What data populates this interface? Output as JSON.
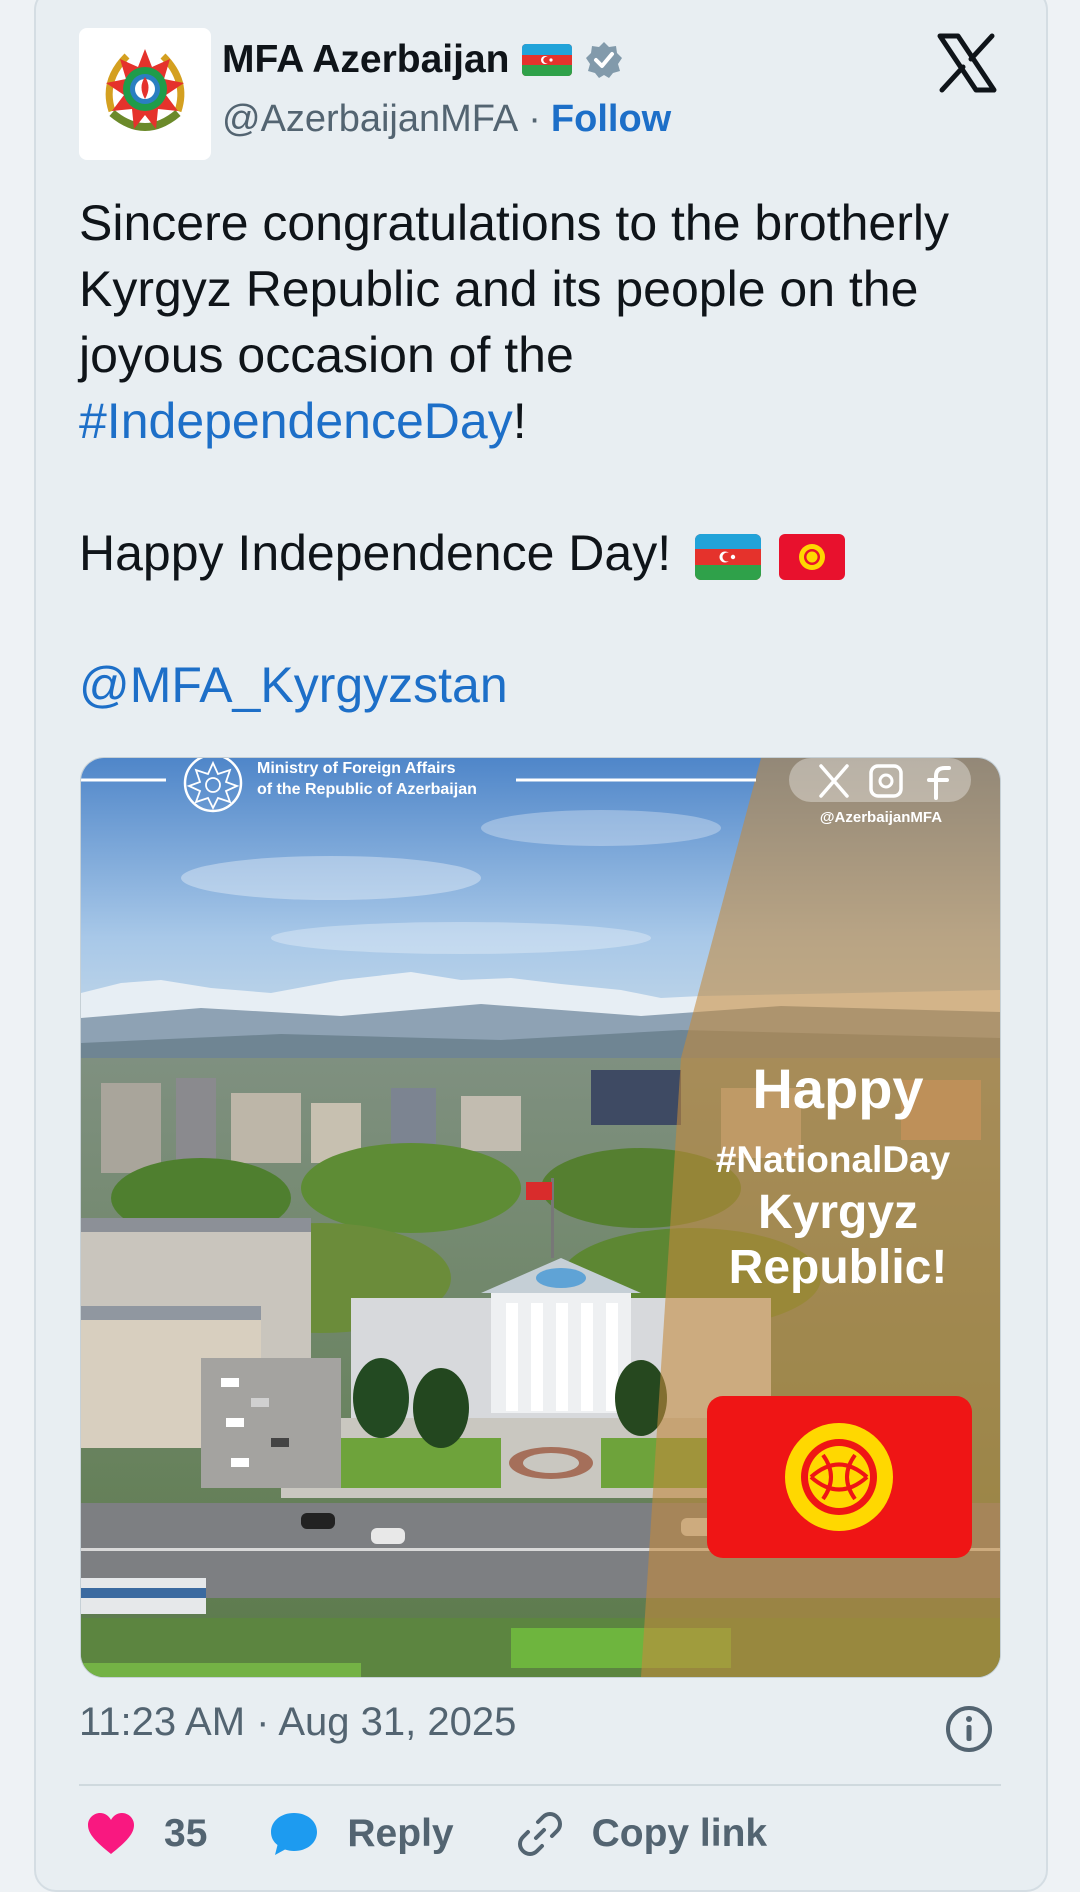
{
  "account": {
    "name": "MFA Azerbaijan",
    "handle": "@AzerbaijanMFA",
    "separator": "·",
    "follow_label": "Follow"
  },
  "tweet": {
    "line1": "Sincere congratulations to the brotherly Kyrgyz Republic and its people on the joyous occasion of the ",
    "hashtag": "#IndependenceDay",
    "exclaim": "!",
    "line2": "Happy Independence Day!",
    "mention": "@MFA_Kyrgyzstan"
  },
  "media": {
    "ministry_line1": "Ministry of Foreign Affairs",
    "ministry_line2": "of the Republic of Azerbaijan",
    "overlay_handle": "@AzerbaijanMFA",
    "greeting_happy": "Happy",
    "greeting_hashtag": "#NationalDay",
    "greeting_country1": "Kyrgyz",
    "greeting_country2": "Republic!"
  },
  "meta": {
    "timestamp": "11:23 AM · Aug 31, 2025"
  },
  "actions": {
    "likes_count": "35",
    "reply_label": "Reply",
    "copy_link_label": "Copy link"
  },
  "colors": {
    "link": "#1d6fc8",
    "like": "#f91880",
    "reply_icon": "#1d9bf0",
    "verified": "#829aab"
  },
  "icons": [
    "x-logo-icon",
    "verified-badge-icon",
    "azerbaijan-flag-icon",
    "kyrgyzstan-flag-icon",
    "info-icon",
    "heart-icon",
    "reply-bubble-icon",
    "link-icon"
  ]
}
